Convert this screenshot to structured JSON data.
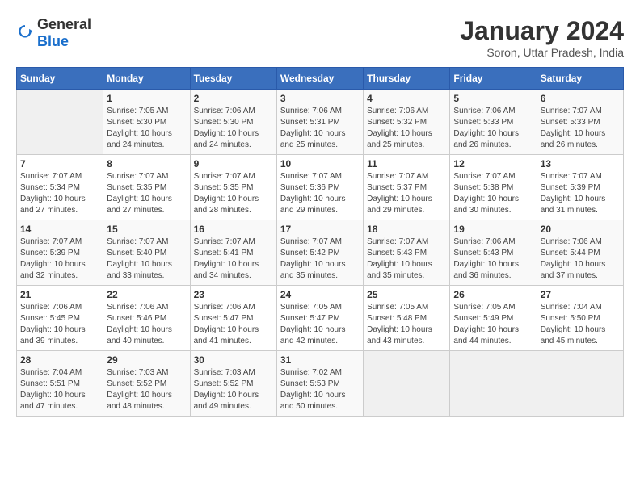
{
  "header": {
    "logo_general": "General",
    "logo_blue": "Blue",
    "title": "January 2024",
    "subtitle": "Soron, Uttar Pradesh, India"
  },
  "days_of_week": [
    "Sunday",
    "Monday",
    "Tuesday",
    "Wednesday",
    "Thursday",
    "Friday",
    "Saturday"
  ],
  "weeks": [
    [
      {
        "day": "",
        "info": ""
      },
      {
        "day": "1",
        "info": "Sunrise: 7:05 AM\nSunset: 5:30 PM\nDaylight: 10 hours\nand 24 minutes."
      },
      {
        "day": "2",
        "info": "Sunrise: 7:06 AM\nSunset: 5:30 PM\nDaylight: 10 hours\nand 24 minutes."
      },
      {
        "day": "3",
        "info": "Sunrise: 7:06 AM\nSunset: 5:31 PM\nDaylight: 10 hours\nand 25 minutes."
      },
      {
        "day": "4",
        "info": "Sunrise: 7:06 AM\nSunset: 5:32 PM\nDaylight: 10 hours\nand 25 minutes."
      },
      {
        "day": "5",
        "info": "Sunrise: 7:06 AM\nSunset: 5:33 PM\nDaylight: 10 hours\nand 26 minutes."
      },
      {
        "day": "6",
        "info": "Sunrise: 7:07 AM\nSunset: 5:33 PM\nDaylight: 10 hours\nand 26 minutes."
      }
    ],
    [
      {
        "day": "7",
        "info": "Sunrise: 7:07 AM\nSunset: 5:34 PM\nDaylight: 10 hours\nand 27 minutes."
      },
      {
        "day": "8",
        "info": "Sunrise: 7:07 AM\nSunset: 5:35 PM\nDaylight: 10 hours\nand 27 minutes."
      },
      {
        "day": "9",
        "info": "Sunrise: 7:07 AM\nSunset: 5:35 PM\nDaylight: 10 hours\nand 28 minutes."
      },
      {
        "day": "10",
        "info": "Sunrise: 7:07 AM\nSunset: 5:36 PM\nDaylight: 10 hours\nand 29 minutes."
      },
      {
        "day": "11",
        "info": "Sunrise: 7:07 AM\nSunset: 5:37 PM\nDaylight: 10 hours\nand 29 minutes."
      },
      {
        "day": "12",
        "info": "Sunrise: 7:07 AM\nSunset: 5:38 PM\nDaylight: 10 hours\nand 30 minutes."
      },
      {
        "day": "13",
        "info": "Sunrise: 7:07 AM\nSunset: 5:39 PM\nDaylight: 10 hours\nand 31 minutes."
      }
    ],
    [
      {
        "day": "14",
        "info": "Sunrise: 7:07 AM\nSunset: 5:39 PM\nDaylight: 10 hours\nand 32 minutes."
      },
      {
        "day": "15",
        "info": "Sunrise: 7:07 AM\nSunset: 5:40 PM\nDaylight: 10 hours\nand 33 minutes."
      },
      {
        "day": "16",
        "info": "Sunrise: 7:07 AM\nSunset: 5:41 PM\nDaylight: 10 hours\nand 34 minutes."
      },
      {
        "day": "17",
        "info": "Sunrise: 7:07 AM\nSunset: 5:42 PM\nDaylight: 10 hours\nand 35 minutes."
      },
      {
        "day": "18",
        "info": "Sunrise: 7:07 AM\nSunset: 5:43 PM\nDaylight: 10 hours\nand 35 minutes."
      },
      {
        "day": "19",
        "info": "Sunrise: 7:06 AM\nSunset: 5:43 PM\nDaylight: 10 hours\nand 36 minutes."
      },
      {
        "day": "20",
        "info": "Sunrise: 7:06 AM\nSunset: 5:44 PM\nDaylight: 10 hours\nand 37 minutes."
      }
    ],
    [
      {
        "day": "21",
        "info": "Sunrise: 7:06 AM\nSunset: 5:45 PM\nDaylight: 10 hours\nand 39 minutes."
      },
      {
        "day": "22",
        "info": "Sunrise: 7:06 AM\nSunset: 5:46 PM\nDaylight: 10 hours\nand 40 minutes."
      },
      {
        "day": "23",
        "info": "Sunrise: 7:06 AM\nSunset: 5:47 PM\nDaylight: 10 hours\nand 41 minutes."
      },
      {
        "day": "24",
        "info": "Sunrise: 7:05 AM\nSunset: 5:47 PM\nDaylight: 10 hours\nand 42 minutes."
      },
      {
        "day": "25",
        "info": "Sunrise: 7:05 AM\nSunset: 5:48 PM\nDaylight: 10 hours\nand 43 minutes."
      },
      {
        "day": "26",
        "info": "Sunrise: 7:05 AM\nSunset: 5:49 PM\nDaylight: 10 hours\nand 44 minutes."
      },
      {
        "day": "27",
        "info": "Sunrise: 7:04 AM\nSunset: 5:50 PM\nDaylight: 10 hours\nand 45 minutes."
      }
    ],
    [
      {
        "day": "28",
        "info": "Sunrise: 7:04 AM\nSunset: 5:51 PM\nDaylight: 10 hours\nand 47 minutes."
      },
      {
        "day": "29",
        "info": "Sunrise: 7:03 AM\nSunset: 5:52 PM\nDaylight: 10 hours\nand 48 minutes."
      },
      {
        "day": "30",
        "info": "Sunrise: 7:03 AM\nSunset: 5:52 PM\nDaylight: 10 hours\nand 49 minutes."
      },
      {
        "day": "31",
        "info": "Sunrise: 7:02 AM\nSunset: 5:53 PM\nDaylight: 10 hours\nand 50 minutes."
      },
      {
        "day": "",
        "info": ""
      },
      {
        "day": "",
        "info": ""
      },
      {
        "day": "",
        "info": ""
      }
    ]
  ]
}
